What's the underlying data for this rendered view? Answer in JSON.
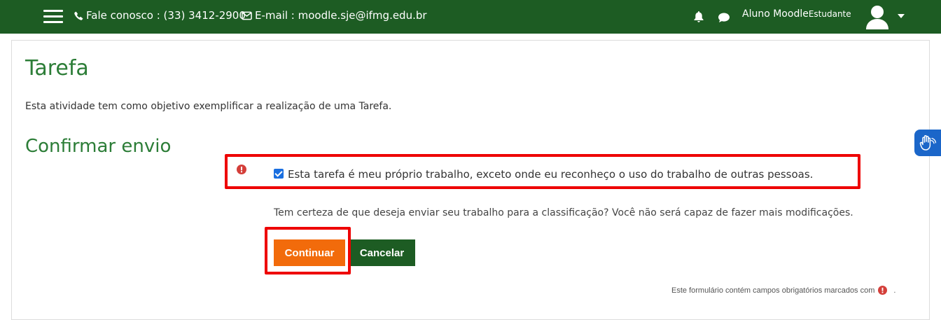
{
  "navbar": {
    "phone_text": "Fale conosco : (33) 3412-2900",
    "email_text": "E-mail : moodle.sje@ifmg.edu.br",
    "user_name": "Aluno Moodle",
    "user_role": "Estudante",
    "icons": [
      "menu-icon",
      "phone-icon",
      "envelope-icon",
      "bell-icon",
      "chat-icon",
      "user-avatar-icon",
      "caret-down-icon"
    ],
    "color": "#1d5c23"
  },
  "page": {
    "title": "Tarefa",
    "description": "Esta atividade tem como objetivo exemplificar a realização de uma Tarefa."
  },
  "form": {
    "section_title": "Confirmar envio",
    "agreement_label": "Esta tarefa é meu próprio trabalho, exceto onde eu reconheço o uso do trabalho de outras pessoas.",
    "agreement_checked": true,
    "confirm_text": "Tem certeza de que deseja enviar seu trabalho para a classificação? Você não será capaz de fazer mais modificações.",
    "continue_label": "Continuar",
    "cancel_label": "Cancelar",
    "required_note": "Este formulário contém campos obrigatórios marcados com",
    "required_note_end": "."
  },
  "colors": {
    "title_green": "#2c7d37",
    "continue_orange": "#f26b0b",
    "cancel_green": "#1d5c23",
    "required_red": "#d43f3a",
    "highlight_red": "#ee0000",
    "accessibility_blue": "#1b66c9"
  }
}
